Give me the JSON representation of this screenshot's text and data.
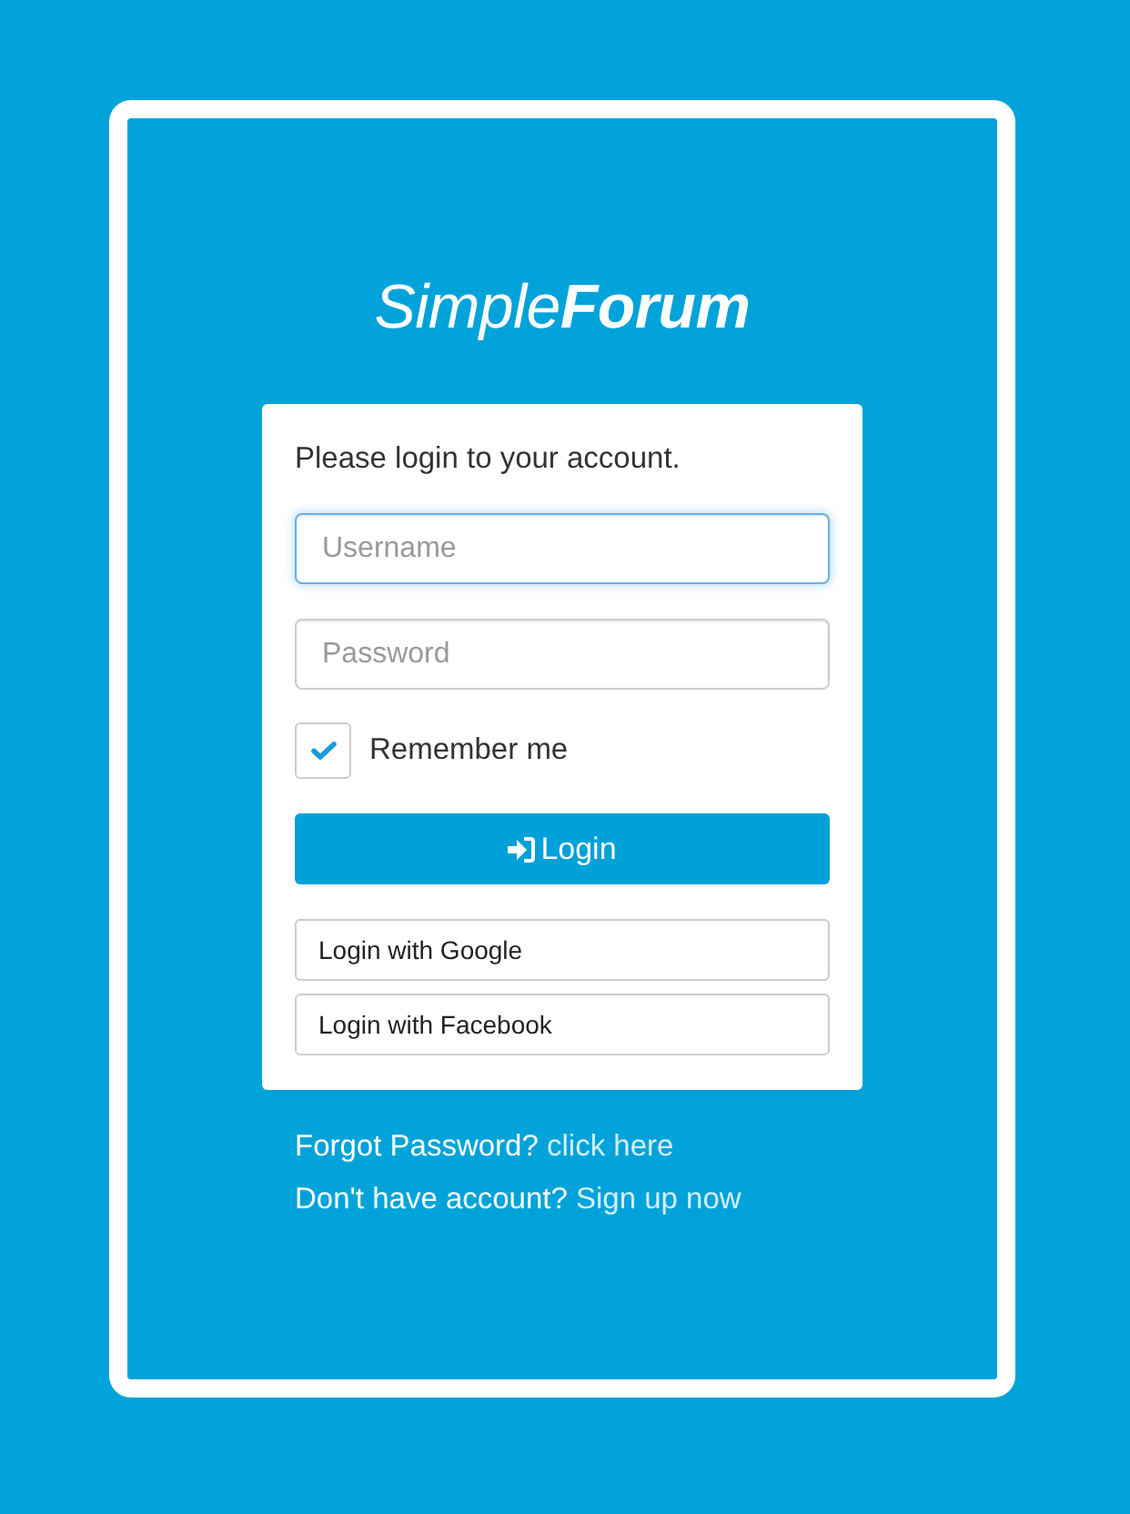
{
  "logo": {
    "light": "Simple",
    "bold": "Forum"
  },
  "card": {
    "prompt": "Please login to your account.",
    "fields": [
      {
        "placeholder": "Username",
        "focused": true
      },
      {
        "placeholder": "Password",
        "focused": false
      }
    ],
    "remember": {
      "label": "Remember me",
      "checked": true
    },
    "login_button": {
      "label": "Login"
    },
    "social_buttons": [
      {
        "label": "Login with Google"
      },
      {
        "label": "Login with Facebook"
      }
    ]
  },
  "links": [
    {
      "text": "Forgot Password?",
      "link": "click here"
    },
    {
      "text": "Don't have account?",
      "link": "Sign up now"
    }
  ]
}
